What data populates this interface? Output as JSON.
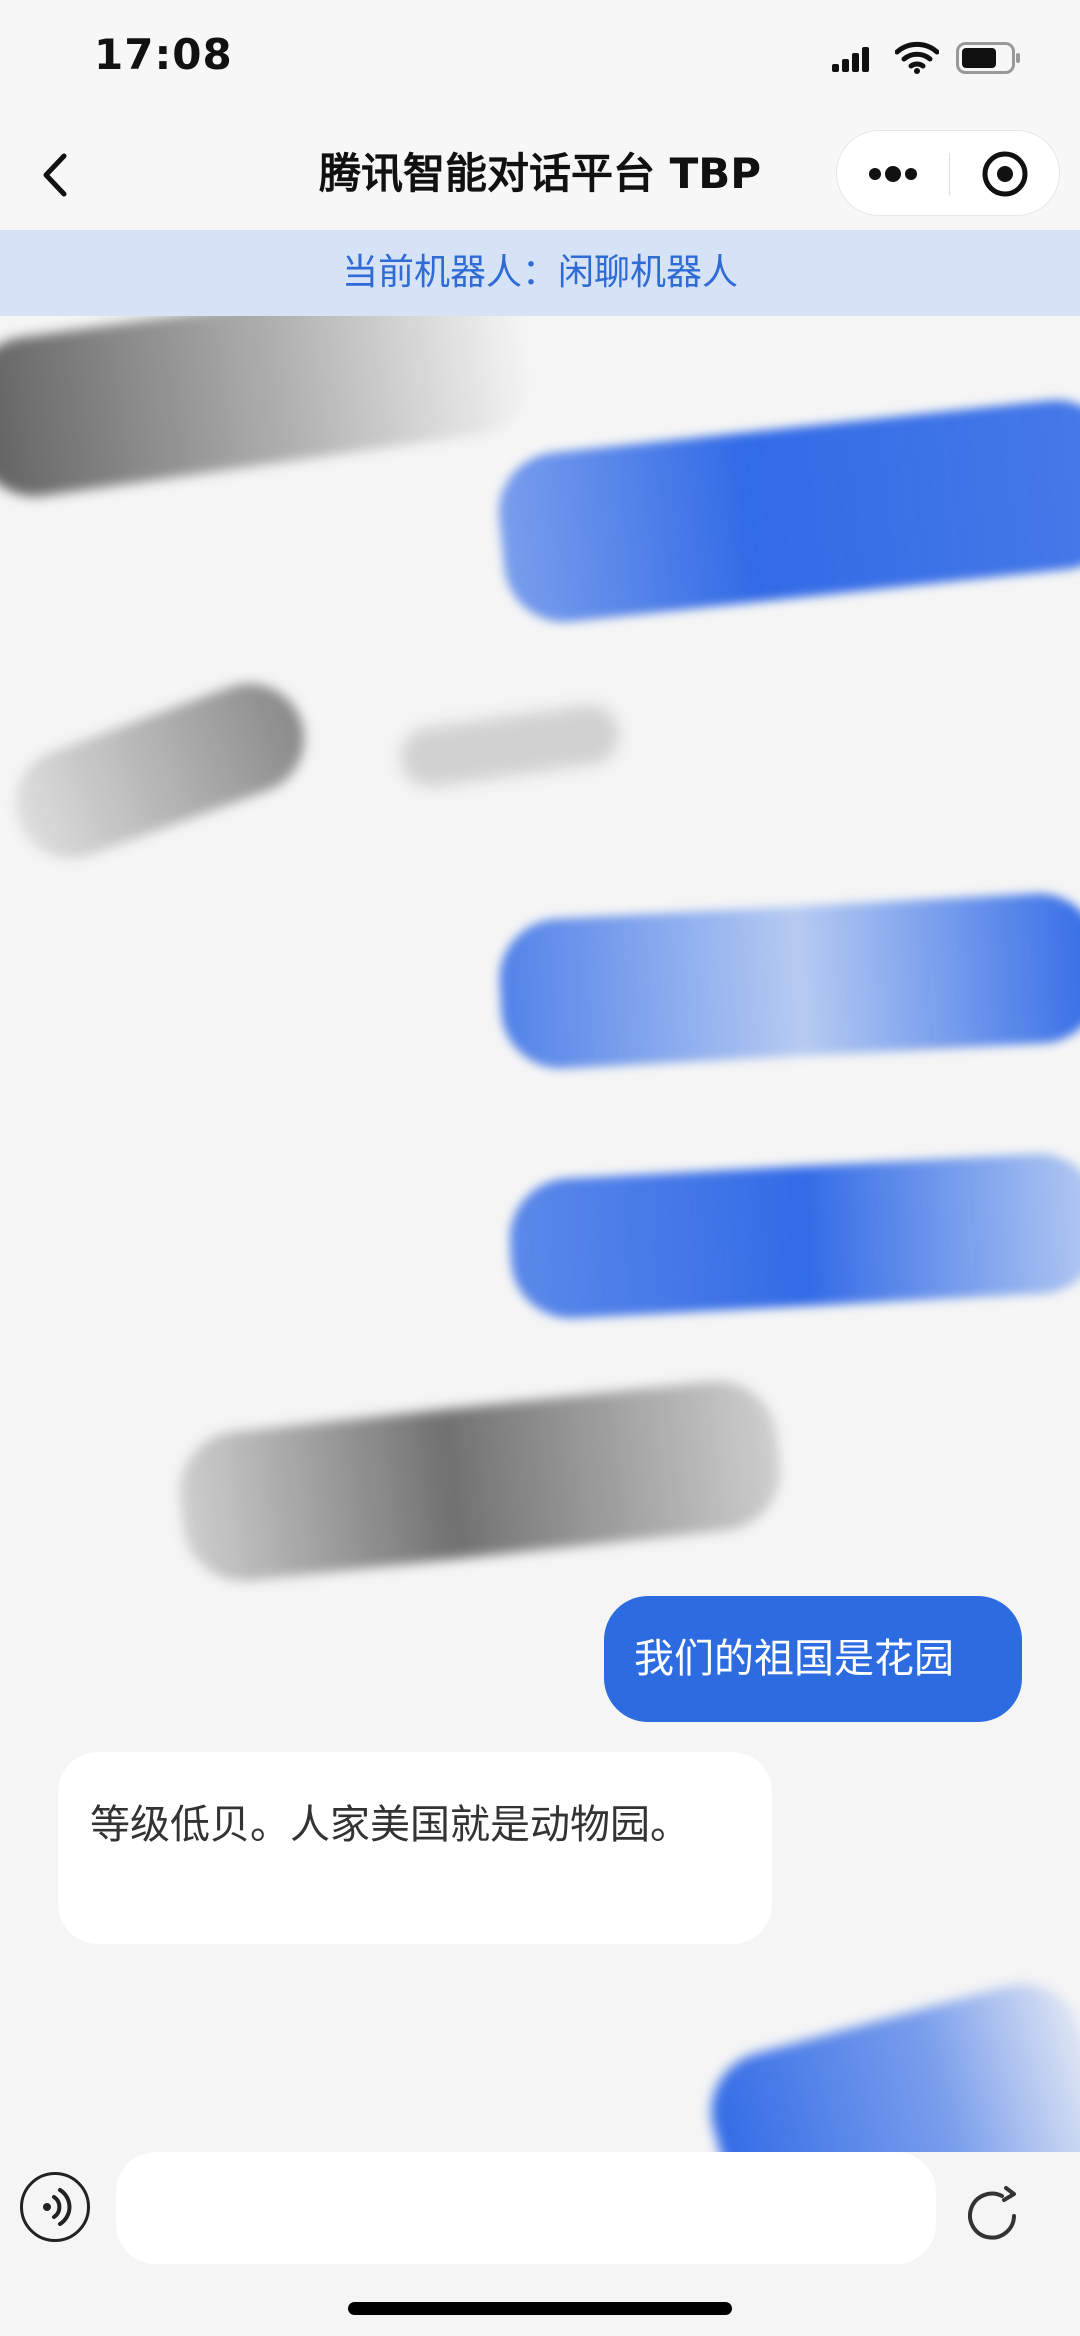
{
  "status_bar": {
    "time": "17:08"
  },
  "nav": {
    "title": "腾讯智能对话平台 TBP"
  },
  "banner": {
    "label": "当前机器人：",
    "robot_name": "闲聊机器人"
  },
  "messages": [
    {
      "role": "user",
      "text": "我们的祖国是花园"
    },
    {
      "role": "bot",
      "text": "等级低贝。人家美国就是动物园。"
    }
  ],
  "input": {
    "value": ""
  },
  "colors": {
    "accent": "#2c6be0",
    "banner_bg": "#d6e2f5",
    "banner_text": "#2f6bd6"
  }
}
